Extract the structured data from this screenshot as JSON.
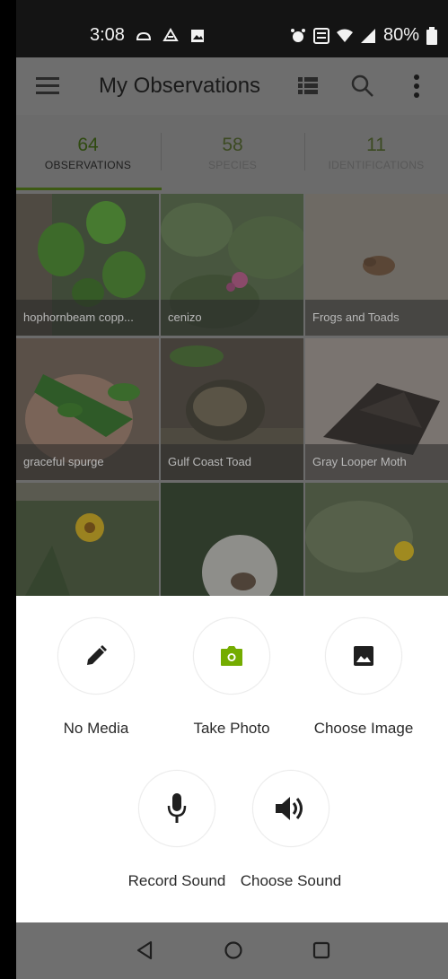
{
  "status_bar": {
    "time": "3:08",
    "battery": "80%"
  },
  "toolbar": {
    "title": "My Observations"
  },
  "tabs": [
    {
      "count": "64",
      "label": "OBSERVATIONS"
    },
    {
      "count": "58",
      "label": "SPECIES"
    },
    {
      "count": "11",
      "label": "IDENTIFICATIONS"
    }
  ],
  "observations": [
    {
      "caption": "hophornbeam copp..."
    },
    {
      "caption": "cenizo"
    },
    {
      "caption": "Frogs and Toads"
    },
    {
      "caption": "graceful spurge"
    },
    {
      "caption": "Gulf Coast Toad"
    },
    {
      "caption": "Gray Looper Moth"
    }
  ],
  "sheet": {
    "no_media": "No Media",
    "take_photo": "Take Photo",
    "choose_image": "Choose Image",
    "record_sound": "Record Sound",
    "choose_sound": "Choose Sound"
  },
  "colors": {
    "accent": "#74ac00",
    "dim_overlay": "#6b6b6b",
    "status_bar": "#141414",
    "nav_bar": "#6f6f6f"
  }
}
